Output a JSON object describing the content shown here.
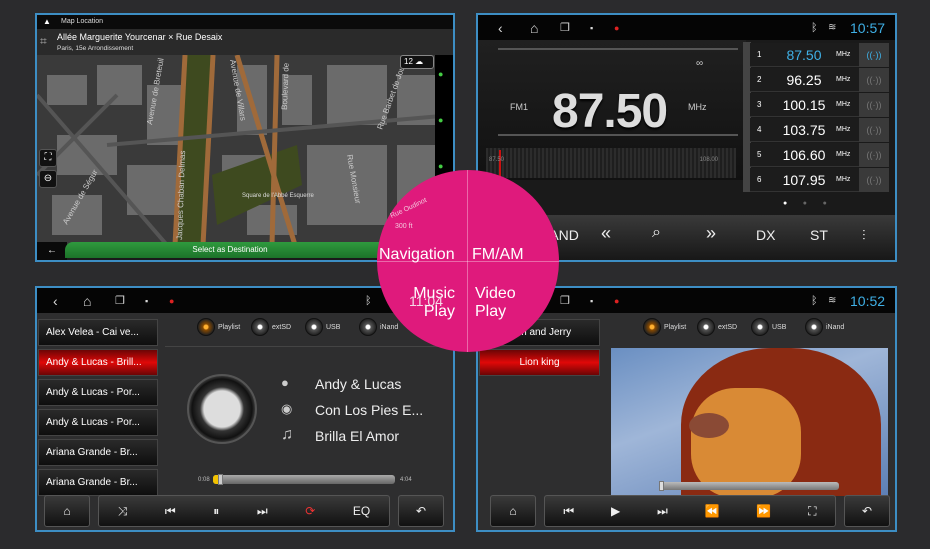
{
  "accent": "#3fb0e6",
  "overlay": {
    "color": "#df1a7c",
    "labels": {
      "navigation": "Navigation",
      "fm_am": "FM/AM",
      "music": "Music\nPlay",
      "video": "Video\nPlay"
    }
  },
  "navigation": {
    "top_label": "Map Location",
    "street": "Allée Marguerite Yourcenar × Rue Desaix",
    "district": "Paris, 15e Arrondissement",
    "zoom_badge": "12",
    "select_button": "Select as Destination",
    "street_labels": [
      "Avenue de Breteuil",
      "Avenue de Villars",
      "Boulevard de",
      "Rue Barbet de Jouy",
      "Rue Monsieur",
      "Avenue de Ségur",
      "Jacques Chaban Delmas",
      "Square de l'Abbé Esquerre",
      "Rue Oudinot",
      "300 ft",
      "Rue Eblé"
    ]
  },
  "radio": {
    "time": "10:57",
    "frequency": "87.50",
    "band": "FM1",
    "unit": "MHz",
    "scale_min": "87.50",
    "scale_max": "108.00",
    "presets": [
      {
        "n": "1",
        "f": "87.50",
        "u": "MHz",
        "active": true
      },
      {
        "n": "2",
        "f": "96.25",
        "u": "MHz"
      },
      {
        "n": "3",
        "f": "100.15",
        "u": "MHz"
      },
      {
        "n": "4",
        "f": "103.75",
        "u": "MHz"
      },
      {
        "n": "5",
        "f": "106.60",
        "u": "MHz"
      },
      {
        "n": "6",
        "f": "107.95",
        "u": "MHz"
      }
    ],
    "buttons": {
      "band": "BAND",
      "dx": "DX",
      "st": "ST"
    },
    "page_index": 1,
    "page_count": 3
  },
  "music": {
    "time": "11:04",
    "playlist": [
      "Alex Velea - Cai ve...",
      "Andy & Lucas - Brill...",
      "Andy & Lucas - Por...",
      "Andy & Lucas - Por...",
      "Ariana Grande - Br...",
      "Ariana Grande - Br..."
    ],
    "active_index": 1,
    "sources": [
      "Playlist",
      "extSD",
      "USB",
      "iNand"
    ],
    "artist": "Andy & Lucas",
    "album": "Con Los Pies E...",
    "title": "Brilla El Amor",
    "elapsed": "0:08",
    "duration": "4:04",
    "progress_percent": 3,
    "eq": "EQ"
  },
  "video": {
    "time": "10:52",
    "playlist": [
      "Tom and Jerry",
      "Lion king"
    ],
    "active_index": 1,
    "sources": [
      "Playlist",
      "extSD",
      "USB",
      "iNand"
    ],
    "progress_percent": 0
  }
}
